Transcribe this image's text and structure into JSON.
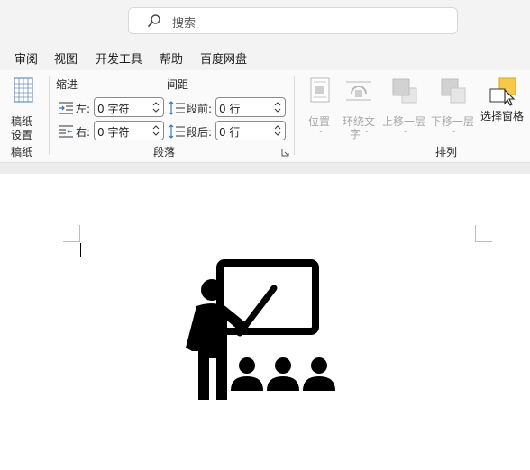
{
  "search": {
    "placeholder": "搜索"
  },
  "tabs": [
    "审阅",
    "视图",
    "开发工具",
    "帮助",
    "百度网盘"
  ],
  "ribbon": {
    "gaozhi": {
      "button_line1": "稿纸",
      "button_line2": "设置",
      "group": "稿纸"
    },
    "paragraph": {
      "indent_title": "缩进",
      "spacing_title": "间距",
      "left_label": "左:",
      "right_label": "右:",
      "before_label": "段前:",
      "after_label": "段后:",
      "left_value": "0 字符",
      "right_value": "0 字符",
      "before_value": "0 行",
      "after_value": "0 行",
      "group": "段落"
    },
    "arrange": {
      "position": "位置",
      "wrap_text_line1": "环绕文",
      "wrap_text_line2": "字",
      "bring_forward": "上移一层",
      "send_backward": "下移一层",
      "selection_pane": "选择窗格",
      "group": "排列"
    }
  },
  "colors": {
    "accent_yellow": "#f7c948",
    "disabled_gray": "#a8a8a8",
    "icon_black": "#000000"
  },
  "document": {
    "image_icon": "teacher-presentation-icon"
  }
}
